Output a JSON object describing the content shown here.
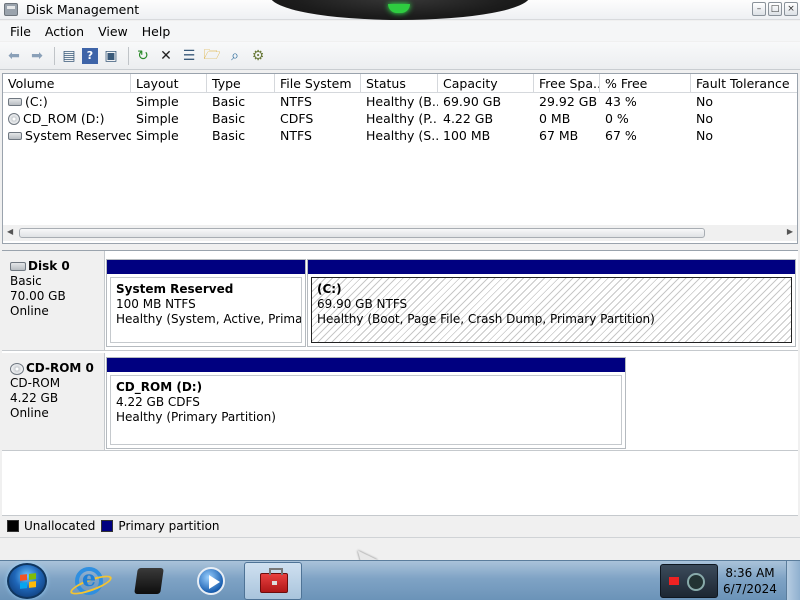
{
  "window": {
    "title": "Disk Management"
  },
  "menu": [
    "File",
    "Action",
    "View",
    "Help"
  ],
  "volume_list": {
    "columns": [
      "Volume",
      "Layout",
      "Type",
      "File System",
      "Status",
      "Capacity",
      "Free Spa...",
      "% Free",
      "Fault Tolerance"
    ],
    "rows": [
      [
        "(C:)",
        "Simple",
        "Basic",
        "NTFS",
        "Healthy (B...",
        "69.90 GB",
        "29.92 GB",
        "43 %",
        "No"
      ],
      [
        "CD_ROM (D:)",
        "Simple",
        "Basic",
        "CDFS",
        "Healthy (P...",
        "4.22 GB",
        "0 MB",
        "0 %",
        "No"
      ],
      [
        "System Reserved",
        "Simple",
        "Basic",
        "NTFS",
        "Healthy (S...",
        "100 MB",
        "67 MB",
        "67 %",
        "No"
      ]
    ]
  },
  "disks": [
    {
      "name": "Disk 0",
      "type": "Basic",
      "size": "70.00 GB",
      "state": "Online",
      "partitions": [
        {
          "title": "System Reserved",
          "size": "100 MB NTFS",
          "status": "Healthy (System, Active, Primary Pa"
        },
        {
          "title": "(C:)",
          "size": "69.90 GB NTFS",
          "status": "Healthy (Boot, Page File, Crash Dump, Primary Partition)"
        }
      ]
    },
    {
      "name": "CD-ROM 0",
      "type": "CD-ROM",
      "size": "4.22 GB",
      "state": "Online",
      "partitions": [
        {
          "title": "CD_ROM  (D:)",
          "size": "4.22 GB CDFS",
          "status": "Healthy (Primary Partition)"
        }
      ]
    }
  ],
  "legend": [
    {
      "label": "Unallocated",
      "color": "#000000"
    },
    {
      "label": "Primary partition",
      "color": "#000080"
    }
  ],
  "taskbar": {
    "apps": [
      "internet-explorer-icon",
      "disk-icon",
      "media-player-icon",
      "toolbox-icon"
    ],
    "time": "8:36 AM",
    "date": "6/7/2024"
  }
}
